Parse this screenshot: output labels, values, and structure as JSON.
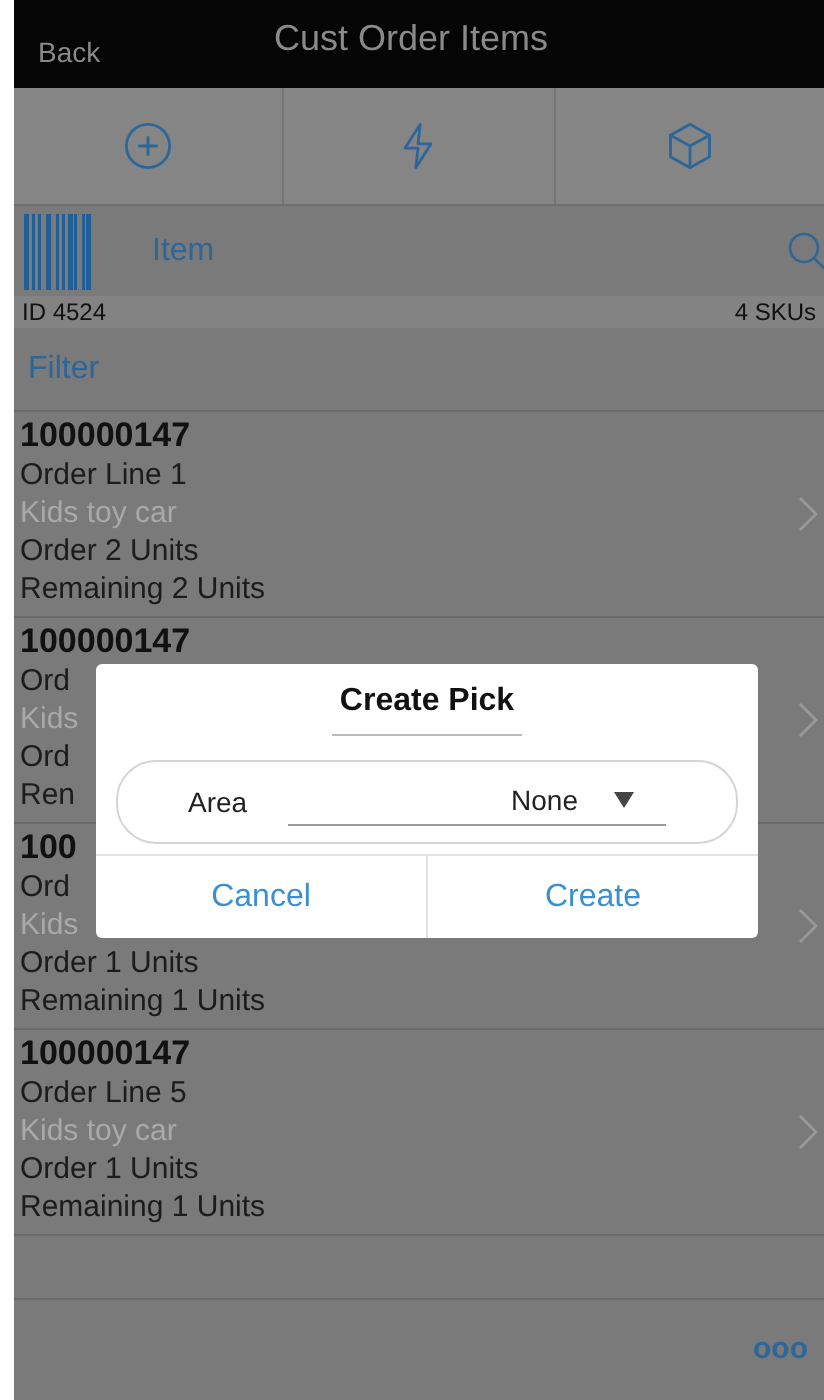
{
  "header": {
    "back": "Back",
    "title": "Cust Order Items"
  },
  "toolbar": [
    {
      "kind": "add"
    },
    {
      "kind": "flash"
    },
    {
      "kind": "package"
    }
  ],
  "scan": {
    "label": "Item",
    "id": "ID 4524",
    "count": "4 SKUs"
  },
  "filter": "Filter",
  "items": [
    {
      "number": "100000147",
      "line": "Order Line 1",
      "description": "Kids toy car",
      "ordered": "Order 2 Units",
      "remaining": "Remaining 2 Units"
    },
    {
      "number": "100000147",
      "line": "Ord",
      "description": "Kids",
      "ordered": "Ord",
      "remaining": "Ren"
    },
    {
      "number": "100",
      "line": "Ord",
      "description": "Kids",
      "ordered": "Order 1 Units",
      "remaining": "Remaining 1 Units"
    },
    {
      "number": "100000147",
      "line": "Order Line 5",
      "description": "Kids toy car",
      "ordered": "Order 1 Units",
      "remaining": "Remaining 1 Units"
    }
  ],
  "more": "ooo",
  "dialog": {
    "title": "Create Pick",
    "field": {
      "label": "Area",
      "value": "None"
    },
    "buttons": [
      "Cancel",
      "Create"
    ]
  }
}
